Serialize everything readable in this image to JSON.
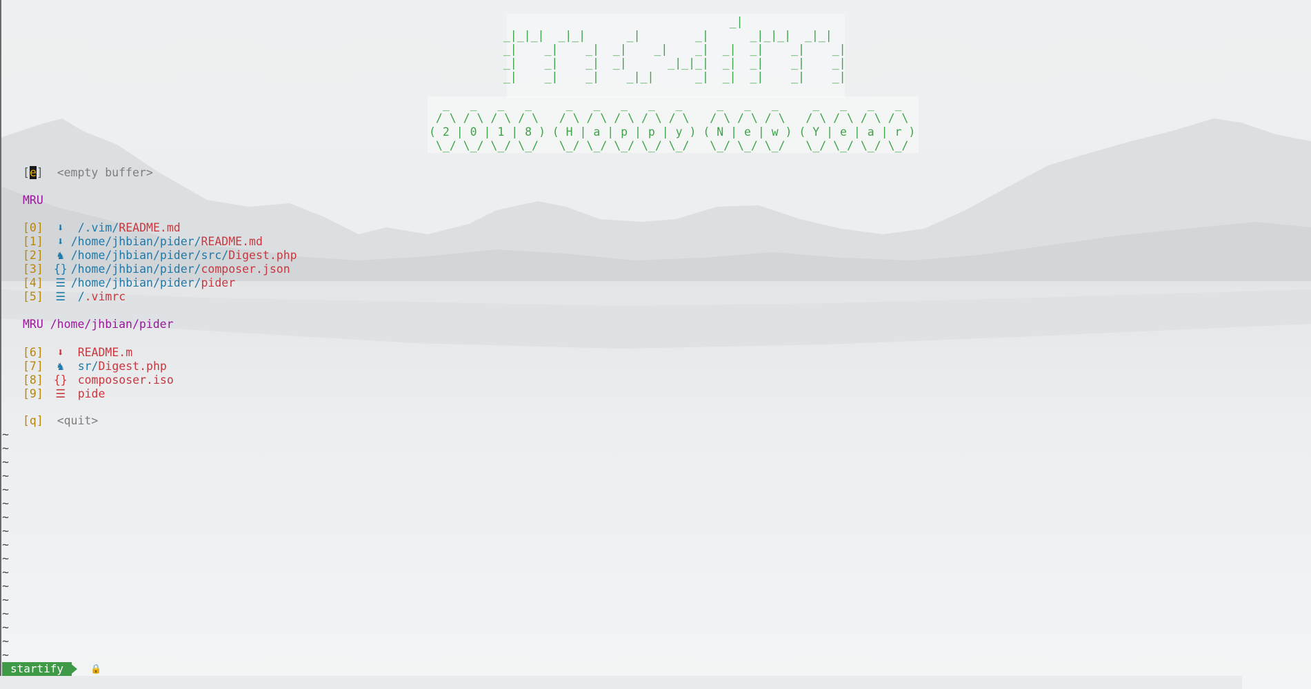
{
  "header_ascii": {
    "logo": "                                   _|\n  _|_|_|  _|_|      _|        _|      _|_|_|  _|_|\n  _|    _|    _|  _|    _|    _|  _|  _|    _|    _|\n  _|    _|    _|  _|      _|_|_|  _|  _|    _|    _|\n  _|    _|    _|    _|_|      _|  _|  _|    _|    _|",
    "banner": "  _   _   _   _     _   _   _   _   _     _   _   _     _   _   _   _\n / \\ / \\ / \\ / \\   / \\ / \\ / \\ / \\ / \\   / \\ / \\ / \\   / \\ / \\ / \\ / \\\n( 2 | 0 | 1 | 8 ) ( H | a | p | p | y ) ( N | e | w ) ( Y | e | a | r )\n \\_/ \\_/ \\_/ \\_/   \\_/ \\_/ \\_/ \\_/ \\_/   \\_/ \\_/ \\_/   \\_/ \\_/ \\_/ \\_/"
  },
  "empty_buffer": {
    "open": "[",
    "key": "e",
    "close": "]",
    "label": "<empty buffer>"
  },
  "mru": {
    "header": "MRU",
    "items": [
      {
        "index": "[0]",
        "icon": "markdown-icon",
        "dir": "/.vim/",
        "file": "README.md"
      },
      {
        "index": "[1]",
        "icon": "markdown-icon",
        "dir": "/home/jhbian/pider/",
        "file": "README.md"
      },
      {
        "index": "[2]",
        "icon": "php-icon",
        "dir": "/home/jhbian/pider/src/",
        "file": "Digest.php"
      },
      {
        "index": "[3]",
        "icon": "json-icon",
        "dir": "/home/jhbian/pider/",
        "file": "composer.json"
      },
      {
        "index": "[4]",
        "icon": "text-file-icon",
        "dir": "/home/jhbian/pider/",
        "file": "pider"
      },
      {
        "index": "[5]",
        "icon": "text-file-icon",
        "dir": "/",
        "file": ".vimrc"
      }
    ]
  },
  "mru_dir": {
    "header": "MRU /home/jhbian/pider",
    "items": [
      {
        "index": "[6]",
        "icon": "markdown-icon",
        "dir": "",
        "file": "README.m"
      },
      {
        "index": "[7]",
        "icon": "php-icon",
        "dir": "sr/",
        "file": "Digest.php"
      },
      {
        "index": "[8]",
        "icon": "json-icon",
        "dir": "",
        "file": "compososer.iso"
      },
      {
        "index": "[9]",
        "icon": "text-file-icon",
        "dir": "",
        "file": "pide"
      }
    ]
  },
  "quit": {
    "index": "[q]",
    "label": "<quit>"
  },
  "tilde": "~",
  "status": {
    "mode": "startify",
    "lock_icon": "lock-icon"
  },
  "colors": {
    "accent_green": "#3e9a47",
    "dir_blue": "#1e78a8",
    "file_red": "#c8383f",
    "header_purple": "#9c169c"
  }
}
